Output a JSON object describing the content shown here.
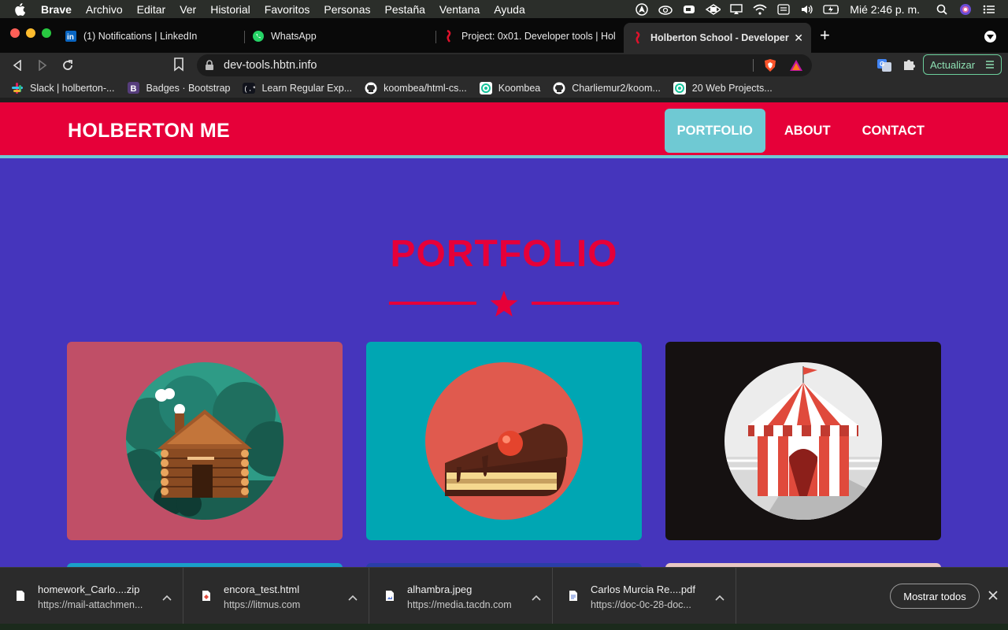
{
  "menubar": {
    "app_name": "Brave",
    "items": [
      "Archivo",
      "Editar",
      "Ver",
      "Historial",
      "Favoritos",
      "Personas",
      "Pestaña",
      "Ventana",
      "Ayuda"
    ],
    "clock": "Mié 2:46 p. m."
  },
  "tabs": [
    {
      "title": "(1) Notifications | LinkedIn",
      "icon": "linkedin-icon"
    },
    {
      "title": "WhatsApp",
      "icon": "whatsapp-icon"
    },
    {
      "title": "Project: 0x01. Developer tools | Hol",
      "icon": "holberton-icon"
    },
    {
      "title": "Holberton School - Developer t",
      "icon": "holberton-icon",
      "active": true
    }
  ],
  "toolbar": {
    "url": "dev-tools.hbtn.info",
    "update_label": "Actualizar"
  },
  "bookmarks": [
    {
      "label": "Slack | holberton-...",
      "icon": "slack-icon"
    },
    {
      "label": "Badges · Bootstrap",
      "icon": "bootstrap-icon"
    },
    {
      "label": "Learn Regular Exp...",
      "icon": "regex-icon"
    },
    {
      "label": "koombea/html-cs...",
      "icon": "github-icon"
    },
    {
      "label": "Koombea",
      "icon": "koombea-icon"
    },
    {
      "label": "Charliemur2/koom...",
      "icon": "github-icon"
    },
    {
      "label": "20 Web Projects...",
      "icon": "koombea-icon"
    }
  ],
  "site": {
    "logo": "HOLBERTON ME",
    "nav": [
      {
        "label": "PORTFOLIO",
        "active": true
      },
      {
        "label": "ABOUT",
        "active": false
      },
      {
        "label": "CONTACT",
        "active": false
      }
    ],
    "section_title": "PORTFOLIO",
    "colors": {
      "header": "#e60039",
      "accent": "#6fc9d3",
      "background": "#4535bc"
    },
    "cards": [
      {
        "name": "cabin",
        "bg": "#c04f67"
      },
      {
        "name": "cake",
        "bg": "#00a6b3"
      },
      {
        "name": "circus-tent",
        "bg": "#151111"
      }
    ]
  },
  "downloads": {
    "items": [
      {
        "name": "homework_Carlo....zip",
        "source": "https://mail-attachmen...",
        "icon": "file-icon"
      },
      {
        "name": "encora_test.html",
        "source": "https://litmus.com",
        "icon": "html-file-icon"
      },
      {
        "name": "alhambra.jpeg",
        "source": "https://media.tacdn.com",
        "icon": "image-file-icon"
      },
      {
        "name": "Carlos Murcia Re....pdf",
        "source": "https://doc-0c-28-doc...",
        "icon": "pdf-file-icon"
      }
    ],
    "show_all_label": "Mostrar todos"
  }
}
